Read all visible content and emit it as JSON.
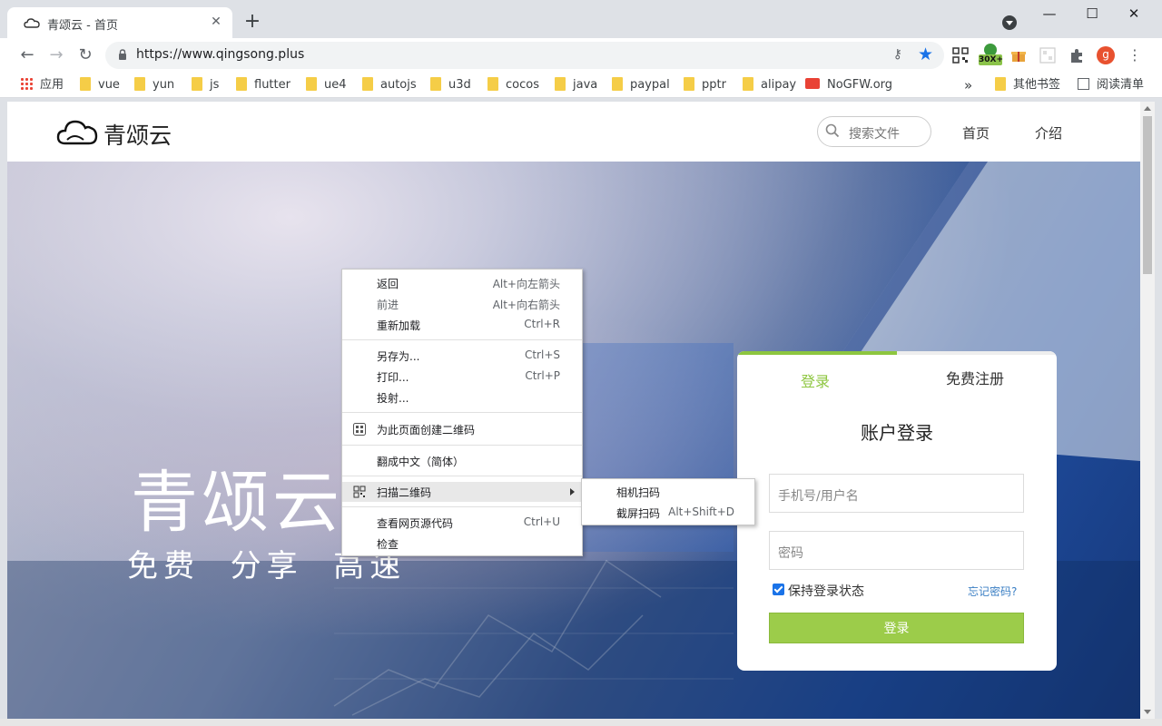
{
  "tab": {
    "title": "青颂云 - 首页",
    "close": "✕",
    "new_tab": "+"
  },
  "window": {
    "minimize": "—",
    "maximize": "☐",
    "close": "✕"
  },
  "toolbar": {
    "back": "←",
    "forward": "→",
    "reload": "↻",
    "url": "https://www.qingsong.plus",
    "key_icon": "key-icon",
    "star_icon": "bookmark-star-icon",
    "ext_badge": "30X+",
    "avatar_letter": "g",
    "menu": "⋮"
  },
  "bookmarks": {
    "apps": "应用",
    "items": [
      "vue",
      "yun",
      "js",
      "flutter",
      "ue4",
      "autojs",
      "u3d",
      "cocos",
      "java",
      "paypal",
      "pptr",
      "alipay"
    ],
    "nogfw": "NoGFW.org",
    "overflow": "»",
    "other": "其他书签",
    "reading_list": "阅读清单"
  },
  "site": {
    "logo_text": "青颂云",
    "search_placeholder": "搜索文件",
    "nav": [
      "首页",
      "介绍"
    ],
    "hero_title": "青颂云",
    "hero_subtitle": "免费  分享  高速"
  },
  "login": {
    "tab_login": "登录",
    "tab_register": "免费注册",
    "title": "账户登录",
    "username_placeholder": "手机号/用户名",
    "password_placeholder": "密码",
    "remember_label": "保持登录状态",
    "remember_checked": true,
    "forgot": "忘记密码?",
    "submit": "登录"
  },
  "context_menu": {
    "back": {
      "label": "返回",
      "shortcut": "Alt+向左箭头"
    },
    "forward": {
      "label": "前进",
      "shortcut": "Alt+向右箭头"
    },
    "reload": {
      "label": "重新加载",
      "shortcut": "Ctrl+R"
    },
    "save_as": {
      "label": "另存为...",
      "shortcut": "Ctrl+S"
    },
    "print": {
      "label": "打印...",
      "shortcut": "Ctrl+P"
    },
    "cast": {
      "label": "投射..."
    },
    "qr_create": {
      "label": "为此页面创建二维码"
    },
    "translate": {
      "label": "翻成中文（简体）"
    },
    "scan_qr": {
      "label": "扫描二维码"
    },
    "view_source": {
      "label": "查看网页源代码",
      "shortcut": "Ctrl+U"
    },
    "inspect": {
      "label": "检查"
    }
  },
  "submenu": {
    "camera": {
      "label": "相机扫码"
    },
    "screen": {
      "label": "截屏扫码",
      "shortcut": "Alt+Shift+D"
    }
  },
  "colors": {
    "accent_green": "#8dc63f",
    "login_button": "#9ccc4a",
    "chrome_blue": "#1a73e8"
  }
}
